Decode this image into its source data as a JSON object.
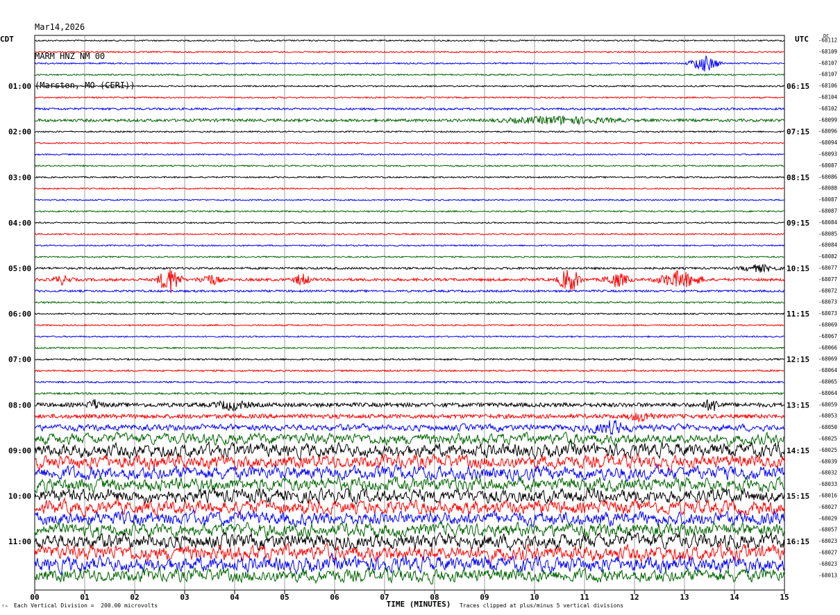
{
  "header": {
    "date": "Mar14,2026",
    "channel": "MARM HNZ NM 00",
    "location": "(Marston, MO (CERI))"
  },
  "left_label": "CDT",
  "right_label": "UTC",
  "dc_label": "DC",
  "footer": {
    "scale": "Each Vertical Division =  200.00 microvolts",
    "clip": "Traces clipped at plus/minus 5 vertical divisions",
    "corner_mark": "ᵀᴬ"
  },
  "colors": {
    "black": "#000000",
    "red": "#ff0000",
    "blue": "#0000ff",
    "green": "#006400"
  },
  "chart_data": {
    "type": "line",
    "title": "MARM HNZ NM 00",
    "xlabel": "TIME (MINUTES)",
    "xlim": [
      0,
      15
    ],
    "x_ticks": [
      "00",
      "01",
      "02",
      "03",
      "04",
      "05",
      "06",
      "07",
      "08",
      "09",
      "10",
      "11",
      "12",
      "13",
      "14",
      "15"
    ],
    "left_time_labels": [
      {
        "row": 4,
        "label": "01:00"
      },
      {
        "row": 8,
        "label": "02:00"
      },
      {
        "row": 12,
        "label": "03:00"
      },
      {
        "row": 16,
        "label": "04:00"
      },
      {
        "row": 20,
        "label": "05:00"
      },
      {
        "row": 24,
        "label": "06:00"
      },
      {
        "row": 28,
        "label": "07:00"
      },
      {
        "row": 32,
        "label": "08:00"
      },
      {
        "row": 36,
        "label": "09:00"
      },
      {
        "row": 40,
        "label": "10:00"
      },
      {
        "row": 44,
        "label": "11:00"
      }
    ],
    "right_time_labels": [
      {
        "row": 4,
        "label": "06:15"
      },
      {
        "row": 8,
        "label": "07:15"
      },
      {
        "row": 12,
        "label": "08:15"
      },
      {
        "row": 16,
        "label": "09:15"
      },
      {
        "row": 20,
        "label": "10:15"
      },
      {
        "row": 24,
        "label": "11:15"
      },
      {
        "row": 28,
        "label": "12:15"
      },
      {
        "row": 32,
        "label": "13:15"
      },
      {
        "row": 36,
        "label": "14:15"
      },
      {
        "row": 40,
        "label": "15:15"
      },
      {
        "row": 44,
        "label": "16:15"
      }
    ],
    "dc_offsets": [
      "-68112",
      "-68109",
      "-68107",
      "-68107",
      "-68106",
      "-68104",
      "-68102",
      "-68099",
      "-68096",
      "-68094",
      "-68093",
      "-68087",
      "-68086",
      "-68088",
      "-68087",
      "-68087",
      "-68084",
      "-68085",
      "-68084",
      "-68082",
      "-68077",
      "-68077",
      "-68072",
      "-68073",
      "-68073",
      "-68069",
      "-68067",
      "-68066",
      "-68069",
      "-68064",
      "-68065",
      "-68064",
      "-68059",
      "-68053",
      "-68050",
      "-68025",
      "-68025",
      "-68039",
      "-68032",
      "-68033",
      "-68016",
      "-68027",
      "-68029",
      "-68057",
      "-68023",
      "-68027",
      "-68023",
      "-68013"
    ],
    "trace_color_cycle": [
      "black",
      "red",
      "blue",
      "green"
    ],
    "trace_noise_level": [
      1,
      1,
      1,
      1,
      1,
      1,
      1.5,
      2,
      1,
      1,
      1,
      1,
      1,
      1,
      1,
      1,
      1,
      1,
      1,
      1,
      1.5,
      2,
      1.5,
      1.2,
      1,
      1,
      1,
      1,
      1.2,
      1.2,
      1.2,
      1.3,
      3,
      3,
      5,
      8,
      10,
      10,
      10,
      10,
      10,
      10,
      10,
      10,
      11,
      11,
      11,
      10
    ],
    "events": [
      {
        "row": 2,
        "start": 13.0,
        "end": 13.8,
        "amp": 12
      },
      {
        "row": 7,
        "start": 9.0,
        "end": 12.0,
        "amp": 5
      },
      {
        "row": 20,
        "start": 14.0,
        "end": 15.0,
        "amp": 5
      },
      {
        "row": 21,
        "start": 0.3,
        "end": 0.8,
        "amp": 6
      },
      {
        "row": 21,
        "start": 2.4,
        "end": 3.0,
        "amp": 20
      },
      {
        "row": 21,
        "start": 3.2,
        "end": 3.8,
        "amp": 8
      },
      {
        "row": 21,
        "start": 5.1,
        "end": 5.6,
        "amp": 8
      },
      {
        "row": 21,
        "start": 10.4,
        "end": 11.0,
        "amp": 18
      },
      {
        "row": 21,
        "start": 11.3,
        "end": 12.0,
        "amp": 10
      },
      {
        "row": 21,
        "start": 12.3,
        "end": 13.5,
        "amp": 12
      },
      {
        "row": 32,
        "start": 1.0,
        "end": 1.4,
        "amp": 6
      },
      {
        "row": 32,
        "start": 3.5,
        "end": 4.4,
        "amp": 6
      },
      {
        "row": 32,
        "start": 13.3,
        "end": 13.8,
        "amp": 8
      },
      {
        "row": 33,
        "start": 11.8,
        "end": 12.5,
        "amp": 6
      },
      {
        "row": 34,
        "start": 11.0,
        "end": 12.0,
        "amp": 10
      }
    ]
  }
}
